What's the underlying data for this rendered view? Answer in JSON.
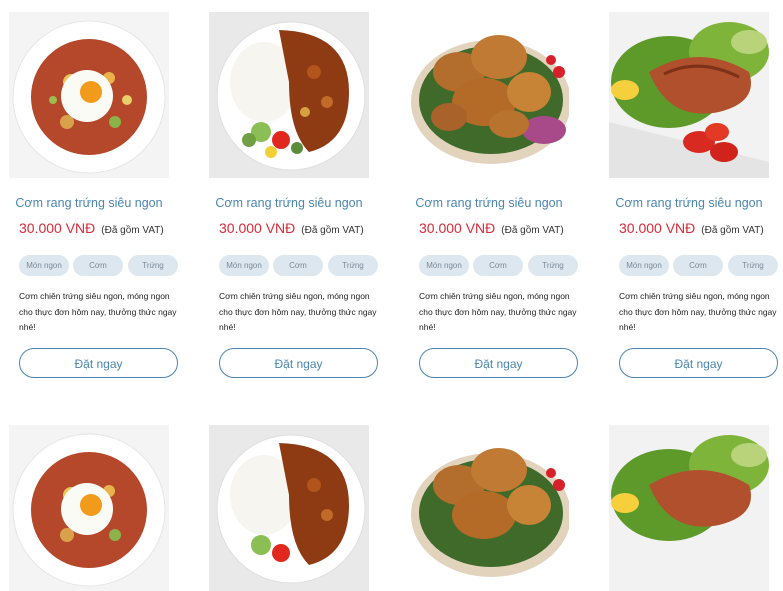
{
  "products": [
    {
      "image": "fried-rice-egg",
      "title": "Cơm rang trứng siêu ngon",
      "price": "30.000 VNĐ",
      "vat": "(Đã gồm VAT)",
      "tags": [
        "Món ngon",
        "Cơm",
        "Trứng"
      ],
      "description": "Cơm chiên trứng siêu ngon, móng ngon cho thực đơn hôm nay, thưởng thức ngay nhé!",
      "order_label": "Đặt ngay"
    },
    {
      "image": "curry-rice-salad",
      "title": "Cơm rang trứng siêu ngon",
      "price": "30.000 VNĐ",
      "vat": "(Đã gồm VAT)",
      "tags": [
        "Món ngon",
        "Cơm",
        "Trứng"
      ],
      "description": "Cơm chiên trứng siêu ngon, móng ngon cho thực đơn hôm nay, thưởng thức ngay nhé!",
      "order_label": "Đặt ngay"
    },
    {
      "image": "fried-chicken",
      "title": "Cơm rang trứng siêu ngon",
      "price": "30.000 VNĐ",
      "vat": "(Đã gồm VAT)",
      "tags": [
        "Món ngon",
        "Cơm",
        "Trứng"
      ],
      "description": "Cơm chiên trứng siêu ngon, móng ngon cho thực đơn hôm nay, thưởng thức ngay nhé!",
      "order_label": "Đặt ngay"
    },
    {
      "image": "grilled-salmon",
      "title": "Cơm rang trứng siêu ngon",
      "price": "30.000 VNĐ",
      "vat": "(Đã gồm VAT)",
      "tags": [
        "Món ngon",
        "Cơm",
        "Trứng"
      ],
      "description": "Cơm chiên trứng siêu ngon, móng ngon cho thực đơn hôm nay, thưởng thức ngay nhé!",
      "order_label": "Đặt ngay"
    },
    {
      "image": "fried-rice-egg"
    },
    {
      "image": "curry-rice-salad"
    },
    {
      "image": "fried-chicken"
    },
    {
      "image": "grilled-salmon"
    }
  ]
}
